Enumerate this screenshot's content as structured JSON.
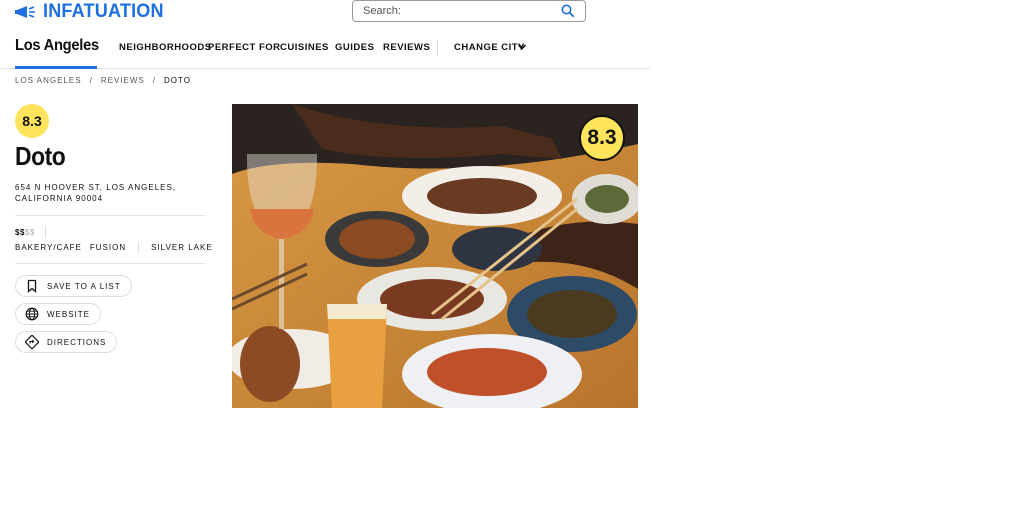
{
  "header": {
    "logo_text": "INFATUATION",
    "search_placeholder": "Search:"
  },
  "nav": {
    "city": "Los Angeles",
    "items": [
      "NEIGHBORHOODS",
      "PERFECT FOR",
      "CUISINES",
      "GUIDES",
      "REVIEWS"
    ],
    "change_city": "CHANGE CITY"
  },
  "breadcrumb": [
    "LOS ANGELES",
    "/",
    "REVIEWS",
    "/",
    "DOTO"
  ],
  "restaurant": {
    "score": "8.3",
    "name": "Doto",
    "address_line1": "654 N HOOVER ST, LOS ANGELES,",
    "address_line2": "CALIFORNIA 90004",
    "price_active": "$$",
    "price_inactive": "$$",
    "tags": [
      "BAKERY/CAFE",
      "FUSION",
      "SILVER LAKE"
    ]
  },
  "actions": {
    "save": "SAVE TO A LIST",
    "website": "WEBSITE",
    "directions": "DIRECTIONS"
  },
  "colors": {
    "brand_blue": "#1e6fe0",
    "score_yellow": "#ffe45c"
  },
  "icons": {
    "logo": "megaphone-icon",
    "search": "search-icon",
    "change_city": "chevron-down-icon",
    "save": "bookmark-icon",
    "website": "globe-icon",
    "directions": "directions-sign-icon"
  }
}
